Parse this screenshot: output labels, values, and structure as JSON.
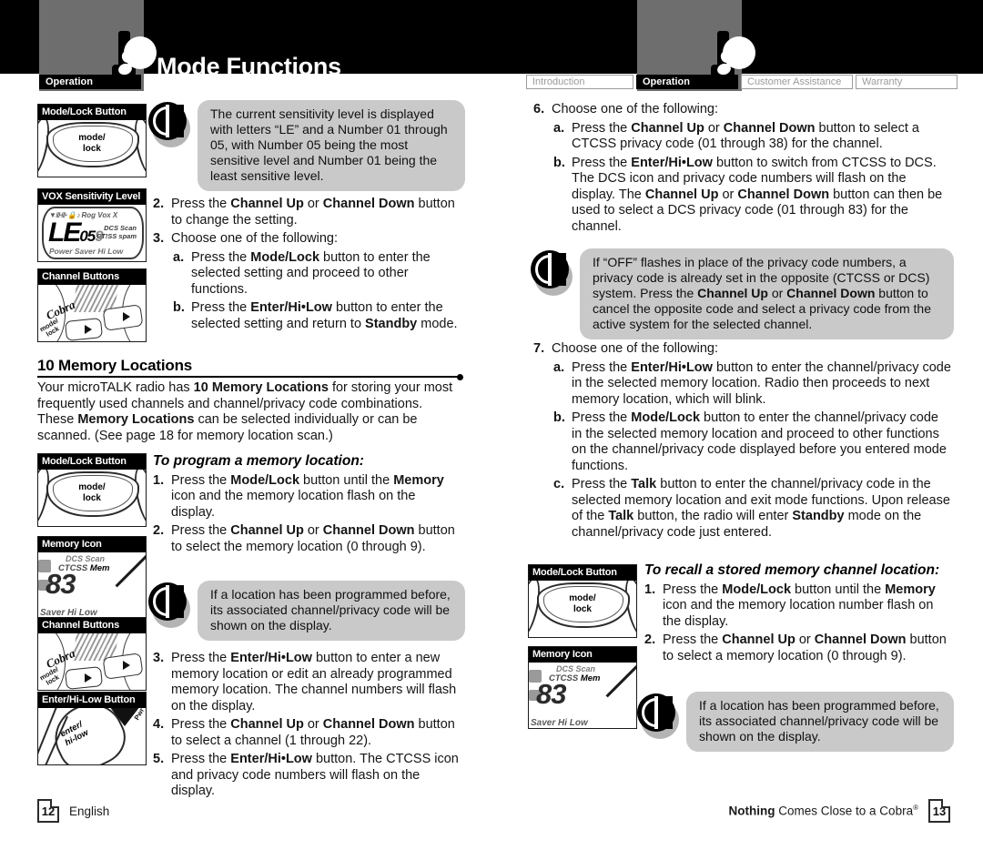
{
  "header": {
    "title": "Mode Functions",
    "badge_label": "Operation",
    "icon": "two-way-radio-icon"
  },
  "tabs_left": [
    {
      "label": "Operation",
      "active": true
    }
  ],
  "tabs_right": [
    {
      "label": "Introduction",
      "active": false
    },
    {
      "label": "Operation",
      "active": true
    },
    {
      "label": "Customer Assistance",
      "active": false
    },
    {
      "label": "Warranty",
      "active": false
    }
  ],
  "panels": {
    "mode_lock_button": "Mode/Lock Button",
    "vox_sensitivity_level": "VOX Sensitivity Level",
    "channel_buttons": "Channel Buttons",
    "memory_icon": "Memory Icon",
    "enter_hi_low_button": "Enter/Hi-Low Button",
    "key_label_line1": "mode/",
    "key_label_line2": "lock",
    "enter_label_line1": "enter/",
    "enter_label_line2": "hi-low",
    "brand": "Cobra",
    "lcd_vox": {
      "top_icons": "Rog Vox X",
      "main": "LE",
      "sub_small": "05",
      "sub_ghost": "9",
      "side_top": "DCS  Scan",
      "side_bottom": "CT!SS spam",
      "bottom": "Power Saver Hi Low"
    },
    "lcd_memory": {
      "top": "DCS  Scan",
      "mid_left": "CTCSS",
      "mid_mem": "Mem",
      "digits": "83",
      "bottom": "Saver  Hi Low"
    }
  },
  "left_column": {
    "tip_1": {
      "icon": "info-circle-icon",
      "text": "The current sensitivity level is displayed with letters “LE” and a Number 01 through 05, with Number 05 being the most sensitive level and Number 01 being the least sensitive level."
    },
    "steps": [
      {
        "marker": "2.",
        "parts": [
          {
            "t": "Press the ",
            "b": false
          },
          {
            "t": "Channel Up",
            "b": true
          },
          {
            "t": " or ",
            "b": false
          },
          {
            "t": "Channel Down",
            "b": true
          },
          {
            "t": " button to change the setting.",
            "b": false
          }
        ]
      },
      {
        "marker": "3.",
        "parts": [
          {
            "t": "Choose one of the following:",
            "b": false
          }
        ]
      }
    ],
    "substeps": [
      {
        "marker": "a.",
        "parts": [
          {
            "t": "Press the ",
            "b": false
          },
          {
            "t": "Mode/Lock",
            "b": true
          },
          {
            "t": " button to enter the selected setting and proceed to other functions.",
            "b": false
          }
        ]
      },
      {
        "marker": "b.",
        "parts": [
          {
            "t": "Press the ",
            "b": false
          },
          {
            "t": "Enter/Hi•Low",
            "b": true
          },
          {
            "t": " button to enter the selected setting and return to ",
            "b": false
          },
          {
            "t": "Standby",
            "b": true
          },
          {
            "t": " mode.",
            "b": false
          }
        ]
      }
    ],
    "section_heading": "10 Memory Locations",
    "section_body_parts": [
      {
        "t": "Your microTALK radio has ",
        "b": false
      },
      {
        "t": "10 Memory Locations",
        "b": true
      },
      {
        "t": " for storing your most frequently used channels and channel/privacy code combinations. These ",
        "b": false
      },
      {
        "t": "Memory Locations",
        "b": true
      },
      {
        "t": " can be selected individually or can be scanned. (See page 18 for memory location scan.)",
        "b": false
      }
    ],
    "subhead": "To program a memory location:",
    "program_steps": [
      {
        "marker": "1.",
        "parts": [
          {
            "t": "Press the ",
            "b": false
          },
          {
            "t": "Mode/Lock",
            "b": true
          },
          {
            "t": " button until the ",
            "b": false
          },
          {
            "t": "Memory",
            "b": true
          },
          {
            "t": " icon and the memory location flash on the display.",
            "b": false
          }
        ]
      },
      {
        "marker": "2.",
        "parts": [
          {
            "t": "Press the ",
            "b": false
          },
          {
            "t": "Channel Up",
            "b": true
          },
          {
            "t": " or ",
            "b": false
          },
          {
            "t": "Channel Down",
            "b": true
          },
          {
            "t": " button to select the memory location (0 through 9).",
            "b": false
          }
        ]
      }
    ],
    "tip_2": {
      "icon": "info-circle-icon",
      "text": "If a location has been programmed before, its associated channel/privacy code will be shown on the display."
    },
    "program_steps_2": [
      {
        "marker": "3.",
        "parts": [
          {
            "t": "Press the ",
            "b": false
          },
          {
            "t": "Enter/Hi•Low",
            "b": true
          },
          {
            "t": " button to enter a new memory location or edit an already programmed memory location. The channel numbers will flash on the display.",
            "b": false
          }
        ]
      },
      {
        "marker": "4.",
        "parts": [
          {
            "t": "Press the ",
            "b": false
          },
          {
            "t": "Channel Up",
            "b": true
          },
          {
            "t": " or ",
            "b": false
          },
          {
            "t": "Channel Down",
            "b": true
          },
          {
            "t": " button to select a channel (1 through 22).",
            "b": false
          }
        ]
      },
      {
        "marker": "5.",
        "parts": [
          {
            "t": "Press the ",
            "b": false
          },
          {
            "t": "Enter/Hi•Low",
            "b": true
          },
          {
            "t": " button. The CTCSS icon and privacy code numbers will flash on the display.",
            "b": false
          }
        ]
      }
    ]
  },
  "right_column": {
    "step_6": {
      "marker": "6.",
      "text": "Choose one of the following:"
    },
    "substeps_6": [
      {
        "marker": "a.",
        "parts": [
          {
            "t": "Press the ",
            "b": false
          },
          {
            "t": "Channel Up",
            "b": true
          },
          {
            "t": " or ",
            "b": false
          },
          {
            "t": "Channel Down",
            "b": true
          },
          {
            "t": " button to select a CTCSS privacy code (01 through 38) for the channel.",
            "b": false
          }
        ]
      },
      {
        "marker": "b.",
        "parts": [
          {
            "t": "Press the ",
            "b": false
          },
          {
            "t": "Enter/Hi•Low",
            "b": true
          },
          {
            "t": " button to switch from CTCSS to DCS. The DCS icon and privacy code numbers will flash on the display. The ",
            "b": false
          },
          {
            "t": "Channel Up",
            "b": true
          },
          {
            "t": " or ",
            "b": false
          },
          {
            "t": "Channel Down",
            "b": true
          },
          {
            "t": " button can then be used to select a DCS privacy code (01 through 83) for the channel.",
            "b": false
          }
        ]
      }
    ],
    "tip_3": {
      "icon": "info-circle-icon",
      "parts": [
        {
          "t": "If “OFF” flashes in place of the privacy code numbers, a privacy code is already set in the opposite (CTCSS or DCS) system. Press the ",
          "b": false
        },
        {
          "t": "Channel Up",
          "b": true
        },
        {
          "t": " or ",
          "b": false
        },
        {
          "t": "Channel Down",
          "b": true
        },
        {
          "t": " button to cancel the opposite code and select a privacy code from the active system for the selected channel.",
          "b": false
        }
      ]
    },
    "step_7": {
      "marker": "7.",
      "text": "Choose one of the following:"
    },
    "substeps_7": [
      {
        "marker": "a.",
        "parts": [
          {
            "t": "Press the ",
            "b": false
          },
          {
            "t": "Enter/Hi•Low",
            "b": true
          },
          {
            "t": " button to enter the channel/privacy code in the selected memory location. Radio then proceeds to next memory location, which will blink.",
            "b": false
          }
        ]
      },
      {
        "marker": "b.",
        "parts": [
          {
            "t": "Press the ",
            "b": false
          },
          {
            "t": "Mode/Lock",
            "b": true
          },
          {
            "t": " button to enter the channel/privacy code in the selected memory location and proceed to other functions on the channel/privacy code displayed before you entered mode functions.",
            "b": false
          }
        ]
      },
      {
        "marker": "c.",
        "parts": [
          {
            "t": "Press the ",
            "b": false
          },
          {
            "t": "Talk",
            "b": true
          },
          {
            "t": " button to enter the channel/privacy code in the selected memory location and exit mode functions. Upon release of the ",
            "b": false
          },
          {
            "t": "Talk",
            "b": true
          },
          {
            "t": " button, the radio will enter ",
            "b": false
          },
          {
            "t": "Standby",
            "b": true
          },
          {
            "t": " mode on the channel/privacy code just entered.",
            "b": false
          }
        ]
      }
    ],
    "subhead": "To recall a stored memory channel location:",
    "recall_steps": [
      {
        "marker": "1.",
        "parts": [
          {
            "t": "Press the ",
            "b": false
          },
          {
            "t": "Mode/Lock",
            "b": true
          },
          {
            "t": " button until the ",
            "b": false
          },
          {
            "t": "Memory",
            "b": true
          },
          {
            "t": " icon and the memory location number flash on the display.",
            "b": false
          }
        ]
      },
      {
        "marker": "2.",
        "parts": [
          {
            "t": "Press the ",
            "b": false
          },
          {
            "t": "Channel Up",
            "b": true
          },
          {
            "t": " or ",
            "b": false
          },
          {
            "t": "Channel Down",
            "b": true
          },
          {
            "t": " button to select a memory location (0 through 9).",
            "b": false
          }
        ]
      }
    ],
    "tip_4": {
      "icon": "info-circle-icon",
      "text": "If a location has been programmed before, its associated channel/privacy code will be shown on the display."
    }
  },
  "footer": {
    "page_left": "12",
    "language": "English",
    "tagline_bold": "Nothing",
    "tagline_rest": " Comes Close to a Cobra",
    "tagline_mark": "®",
    "page_right": "13"
  },
  "colors": {
    "header_bg": "#000000",
    "header_accent_gray": "#6e6e6e",
    "tip_bubble": "#c9c9c9",
    "text": "#151515"
  }
}
